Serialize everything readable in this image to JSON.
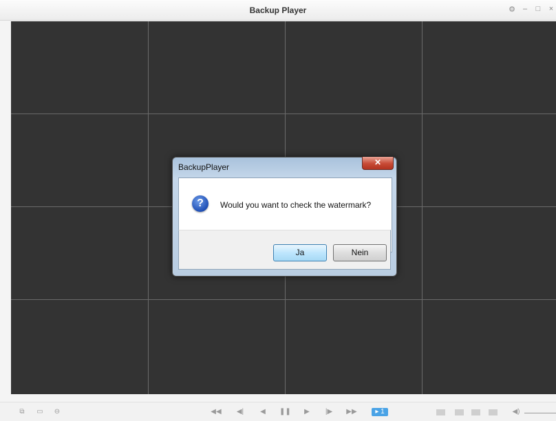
{
  "window": {
    "title": "Backup Player",
    "controls": {
      "settings": "⚙",
      "minimize": "–",
      "maximize": "□",
      "close": "×"
    }
  },
  "video_grid": {
    "rows": 4,
    "cols": 4
  },
  "dialog": {
    "title": "BackupPlayer",
    "close": "✕",
    "icon": "?",
    "message": "Would you want to check the watermark?",
    "buttons": {
      "yes": "Ja",
      "no": "Nein"
    }
  },
  "toolbar": {
    "left": {
      "snapshot": "⧉",
      "folder": "▭",
      "print": "⊖"
    },
    "playback": {
      "fast_rewind": "◀◀",
      "step_back": "◀|",
      "rewind": "◀",
      "pause": "❚❚",
      "play": "▶",
      "step_forward": "|▶",
      "fast_forward": "▶▶",
      "speed": "▸ 1"
    },
    "volume": "◀)"
  }
}
